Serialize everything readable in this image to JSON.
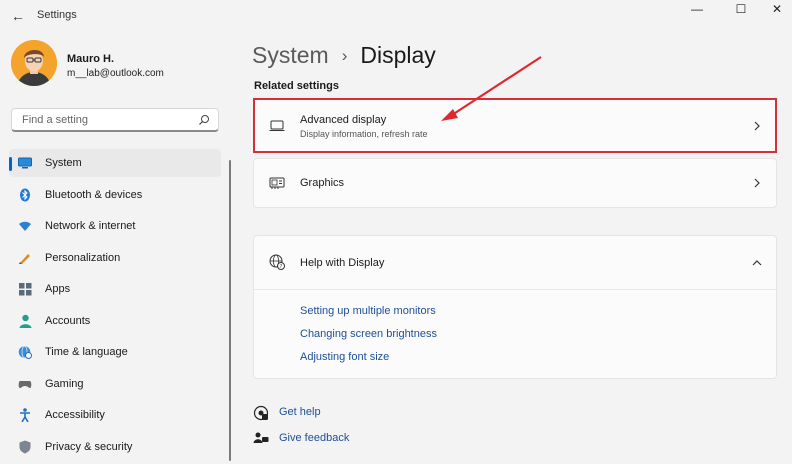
{
  "window": {
    "title": "Settings",
    "back_glyph": "←",
    "minimize_glyph": "—",
    "maximize_glyph": "☐",
    "close_glyph": "✕"
  },
  "profile": {
    "name": "Mauro H.",
    "email": "m__lab@outlook.com"
  },
  "search": {
    "placeholder": "Find a setting",
    "value": ""
  },
  "sidebar": {
    "items": [
      {
        "label": "System",
        "icon": "monitor-icon",
        "active": true
      },
      {
        "label": "Bluetooth & devices",
        "icon": "bluetooth-icon"
      },
      {
        "label": "Network & internet",
        "icon": "wifi-icon"
      },
      {
        "label": "Personalization",
        "icon": "pen-brush-icon"
      },
      {
        "label": "Apps",
        "icon": "apps-grid-icon"
      },
      {
        "label": "Accounts",
        "icon": "person-icon"
      },
      {
        "label": "Time & language",
        "icon": "globe-clock-icon"
      },
      {
        "label": "Gaming",
        "icon": "gamepad-icon"
      },
      {
        "label": "Accessibility",
        "icon": "accessibility-icon"
      },
      {
        "label": "Privacy & security",
        "icon": "shield-icon"
      }
    ]
  },
  "breadcrumb": {
    "parent": "System",
    "separator": "›",
    "current": "Display"
  },
  "main": {
    "related_heading": "Related settings",
    "advanced_display": {
      "title": "Advanced display",
      "subtitle": "Display information, refresh rate",
      "icon": "laptop-icon"
    },
    "graphics": {
      "title": "Graphics",
      "icon": "graphics-card-icon"
    },
    "help": {
      "title": "Help with Display",
      "icon": "globe-help-icon",
      "expanded": true,
      "links": [
        "Setting up multiple monitors",
        "Changing screen brightness",
        "Adjusting font size"
      ]
    }
  },
  "footer": {
    "get_help": "Get help",
    "give_feedback": "Give feedback"
  },
  "colors": {
    "accent": "#0067c0",
    "highlight": "#d62f3b",
    "link": "#1e4f96",
    "background": "#f3f3f3"
  }
}
